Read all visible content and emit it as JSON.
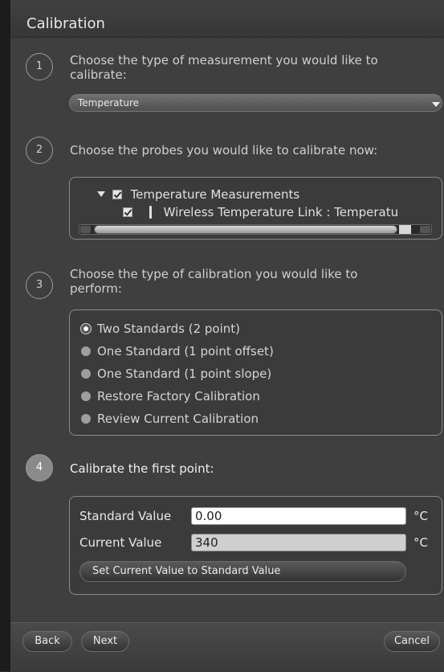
{
  "window": {
    "title": "Calibration"
  },
  "steps": [
    {
      "number": "1",
      "text_line1": "Choose the type of measurement you would like to",
      "text_line2": "calibrate:"
    },
    {
      "number": "2",
      "text_line1": "Choose the probes you would like to calibrate now:"
    },
    {
      "number": "3",
      "text_line1": "Choose the type of calibration you would like to",
      "text_line2": "perform:"
    },
    {
      "number": "4",
      "text_line1": "Calibrate the first point:"
    }
  ],
  "measurement_dropdown": {
    "selected": "Temperature"
  },
  "probe_tree": {
    "group_label": "Temperature Measurements",
    "child_label": "Wireless Temperature Link : Temperatu"
  },
  "calibration_types": [
    {
      "label": "Two Standards (2 point)",
      "selected": true
    },
    {
      "label": "One Standard (1 point offset)",
      "selected": false
    },
    {
      "label": "One Standard (1 point slope)",
      "selected": false
    },
    {
      "label": "Restore Factory Calibration",
      "selected": false
    },
    {
      "label": "Review Current Calibration",
      "selected": false
    }
  ],
  "calibrate_point": {
    "standard_label": "Standard Value",
    "standard_value": "0.00",
    "current_label": "Current Value",
    "current_value": "340",
    "unit": "°C",
    "set_button_label": "Set Current Value to Standard Value"
  },
  "footer": {
    "back_label": "Back",
    "next_label": "Next",
    "cancel_label": "Cancel"
  }
}
